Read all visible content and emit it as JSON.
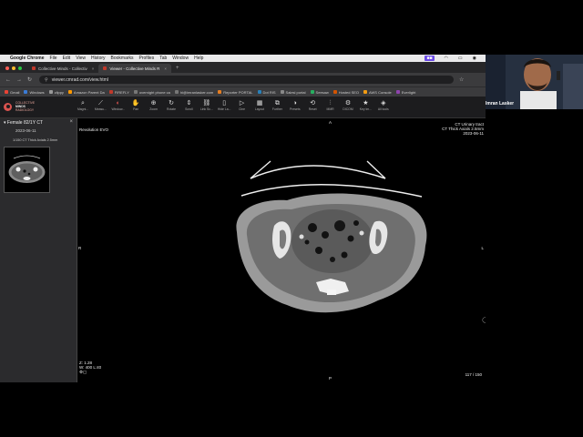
{
  "menubar": {
    "app": "Google Chrome",
    "items": [
      "File",
      "Edit",
      "View",
      "History",
      "Bookmarks",
      "Profiles",
      "Tab",
      "Window",
      "Help"
    ]
  },
  "tabs": [
    {
      "title": "Collective Minds - Collectiv",
      "active": false
    },
    {
      "title": "Viewer - Collective Minds R",
      "active": true
    }
  ],
  "address": {
    "url": "viewer.cmrad.com/view.html"
  },
  "bookmarks": [
    "Gmail",
    "Windows",
    "zlippy",
    "Amazon Parent Da",
    "FIREFLY",
    "overnight phone ca",
    "hi@imranlasker.com",
    "Reporter PORTAL",
    "Dot RIS",
    "Salesl portal",
    "Seesaw",
    "Hosted SEO",
    "AWS Console",
    "Everlight"
  ],
  "logo": {
    "line1": "COLLECTIVE",
    "line2": "MINDS",
    "line3": "RADIOLOGY"
  },
  "toolbar": [
    {
      "label": "Magni...",
      "icon": "magnify-icon",
      "glyph": "⌕"
    },
    {
      "label": "Measu...",
      "icon": "ruler-icon",
      "glyph": "⟋"
    },
    {
      "label": "Window...",
      "icon": "window-level-icon",
      "glyph": "◐",
      "active": true
    },
    {
      "label": "Pan",
      "icon": "pan-icon",
      "glyph": "✋"
    },
    {
      "label": "Zoom",
      "icon": "zoom-icon",
      "glyph": "⊕"
    },
    {
      "label": "Rotate",
      "icon": "rotate-icon",
      "glyph": "↻"
    },
    {
      "label": "Scroll",
      "icon": "scroll-icon",
      "glyph": "⇕"
    },
    {
      "label": "Link Sc...",
      "icon": "link-icon",
      "glyph": "⛓"
    },
    {
      "label": "Hide La...",
      "icon": "hide-layers-icon",
      "glyph": "▯"
    },
    {
      "label": "Cine",
      "icon": "cine-icon",
      "glyph": "▷"
    },
    {
      "label": "Layout",
      "icon": "layout-icon",
      "glyph": "▦"
    },
    {
      "label": "Further",
      "icon": "further-icon",
      "glyph": "⧉"
    },
    {
      "label": "Presets",
      "icon": "presets-icon",
      "glyph": "◑"
    },
    {
      "label": "Reset",
      "icon": "reset-icon",
      "glyph": "⟲"
    },
    {
      "label": "MMR",
      "icon": "mmr-icon",
      "glyph": "⫶"
    },
    {
      "label": "DICOM",
      "icon": "dicom-icon",
      "glyph": "⚙"
    },
    {
      "label": "Key Im...",
      "icon": "star-icon",
      "glyph": "★"
    },
    {
      "label": "All tools",
      "icon": "all-tools-icon",
      "glyph": "◈"
    }
  ],
  "study_panel": {
    "patient": "Female 82/1Y CT",
    "date": "2023-06-11",
    "series": "1/150 CT Thick Axials 2.5mm"
  },
  "viewport": {
    "top_left": "Revolution EVO",
    "top_right": [
      "CT Urinary tract",
      "CT Thick Axials 2.5mm",
      "2023-06-11"
    ],
    "top_marker": "A",
    "bottom_marker": "P",
    "left_marker": "R",
    "right_marker": "L",
    "bottom_left": [
      "Z: 1.28",
      "W: 400 L:40"
    ],
    "bottom_right": "117 / 150"
  },
  "webcam": {
    "name": "Imran Lasker"
  },
  "colors": {
    "accent": "#d9534f",
    "panel": "#2b2b2d",
    "toolbar": "#1c1c1e"
  }
}
